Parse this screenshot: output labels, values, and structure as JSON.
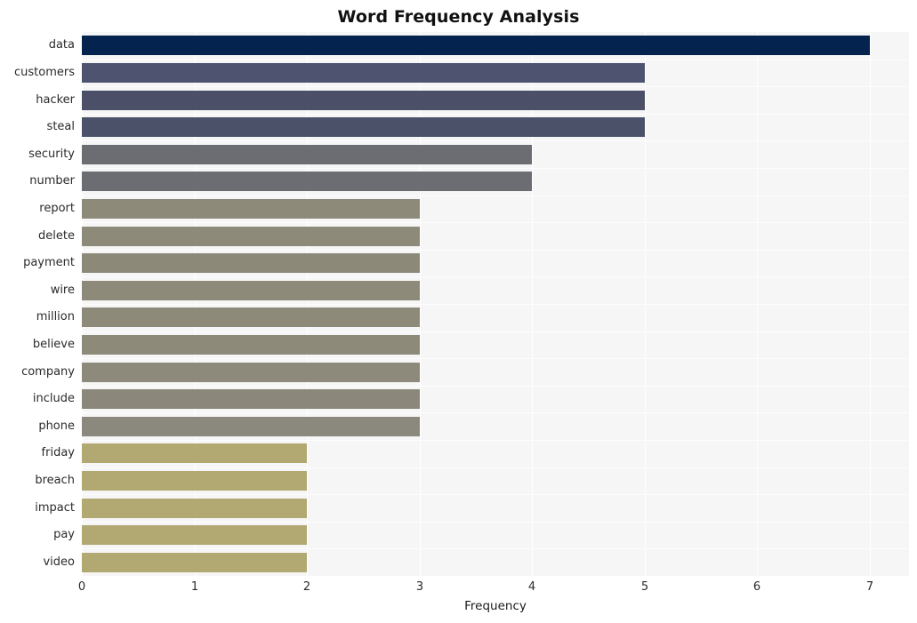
{
  "chart_data": {
    "type": "bar",
    "orientation": "horizontal",
    "title": "Word Frequency Analysis",
    "xlabel": "Frequency",
    "ylabel": "",
    "xlim": [
      0,
      7.35
    ],
    "xticks": [
      "0",
      "1",
      "2",
      "3",
      "4",
      "5",
      "6",
      "7"
    ],
    "xtick_values": [
      0,
      1,
      2,
      3,
      4,
      5,
      6,
      7
    ],
    "grid": true,
    "legend": null,
    "categories": [
      "data",
      "customers",
      "hacker",
      "steal",
      "security",
      "number",
      "report",
      "delete",
      "payment",
      "wire",
      "million",
      "believe",
      "company",
      "include",
      "phone",
      "friday",
      "breach",
      "impact",
      "pay",
      "video"
    ],
    "values": [
      7,
      5,
      5,
      5,
      4,
      4,
      3,
      3,
      3,
      3,
      3,
      3,
      3,
      3,
      3,
      2,
      2,
      2,
      2,
      2
    ],
    "bar_colors": [
      "#04244f",
      "#4e5470",
      "#4b5068",
      "#4b5168",
      "#6b6d72",
      "#6b6d72",
      "#8e8a7a",
      "#8e8a7a",
      "#8d8979",
      "#8d8a7a",
      "#8d8a7a",
      "#8d8a7a",
      "#8e8a7b",
      "#8b877a",
      "#8b887d",
      "#b2a872",
      "#b2a872",
      "#b2a872",
      "#b2a872",
      "#b2a872"
    ],
    "bars": [
      {
        "label": "data",
        "value": 7,
        "color": "#04244f"
      },
      {
        "label": "customers",
        "value": 5,
        "color": "#4e5470"
      },
      {
        "label": "hacker",
        "value": 5,
        "color": "#4b5068"
      },
      {
        "label": "steal",
        "value": 5,
        "color": "#4b5168"
      },
      {
        "label": "security",
        "value": 4,
        "color": "#6b6d72"
      },
      {
        "label": "number",
        "value": 4,
        "color": "#6b6d72"
      },
      {
        "label": "report",
        "value": 3,
        "color": "#8e8a7a"
      },
      {
        "label": "delete",
        "value": 3,
        "color": "#8e8a7a"
      },
      {
        "label": "payment",
        "value": 3,
        "color": "#8d8979"
      },
      {
        "label": "wire",
        "value": 3,
        "color": "#8d8a7a"
      },
      {
        "label": "million",
        "value": 3,
        "color": "#8d8a7a"
      },
      {
        "label": "believe",
        "value": 3,
        "color": "#8d8a7a"
      },
      {
        "label": "company",
        "value": 3,
        "color": "#8e8a7b"
      },
      {
        "label": "include",
        "value": 3,
        "color": "#8b877a"
      },
      {
        "label": "phone",
        "value": 3,
        "color": "#8b887d"
      },
      {
        "label": "friday",
        "value": 2,
        "color": "#b2a872"
      },
      {
        "label": "breach",
        "value": 2,
        "color": "#b2a872"
      },
      {
        "label": "impact",
        "value": 2,
        "color": "#b2a872"
      },
      {
        "label": "pay",
        "value": 2,
        "color": "#b2a872"
      },
      {
        "label": "video",
        "value": 2,
        "color": "#b2a872"
      }
    ],
    "plot_background": "#f6f6f7",
    "gridline_color": "#ffffff"
  }
}
